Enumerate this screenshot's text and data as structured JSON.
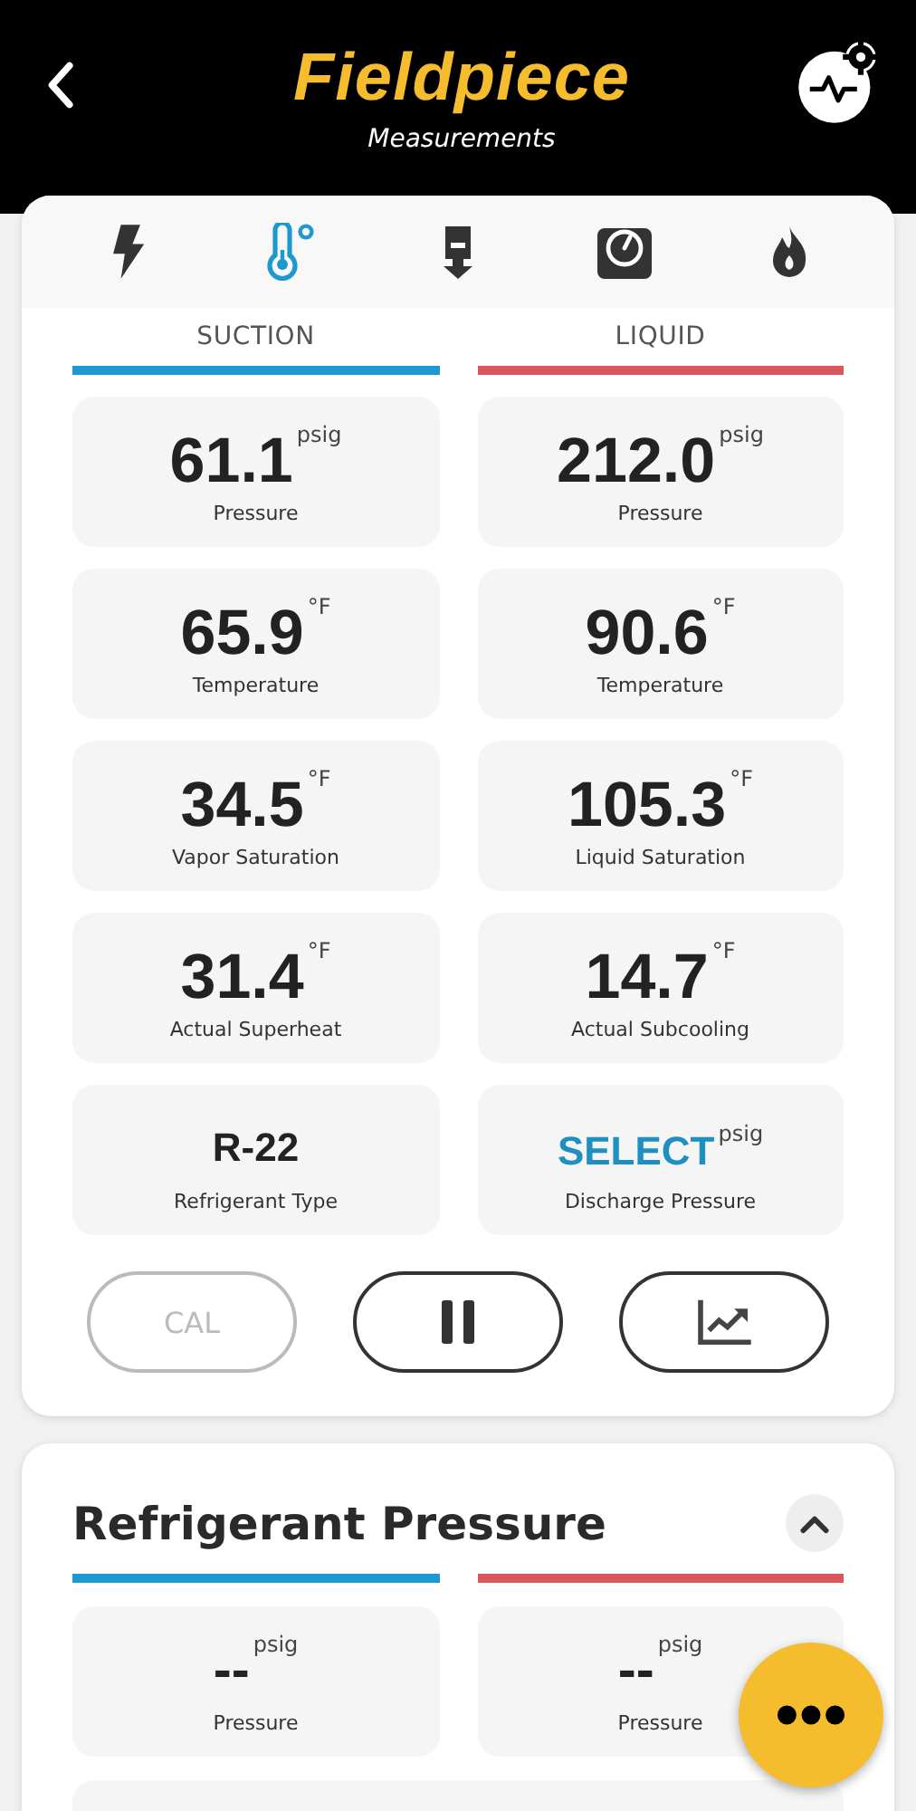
{
  "header": {
    "logo": "Fieldpiece",
    "subtitle": "Measurements"
  },
  "tabs": [
    {
      "kind": "bolt",
      "selected": false
    },
    {
      "kind": "thermometer",
      "selected": true
    },
    {
      "kind": "probe",
      "selected": false
    },
    {
      "kind": "gauge",
      "selected": false
    },
    {
      "kind": "flame",
      "selected": false
    }
  ],
  "columns": [
    {
      "label": "SUCTION",
      "color": "#1e98d0"
    },
    {
      "label": "LIQUID",
      "color": "#d9575c"
    }
  ],
  "tiles": [
    {
      "kind": "value",
      "value": "61.1",
      "unit": "psig",
      "label": "Pressure"
    },
    {
      "kind": "value",
      "value": "212.0",
      "unit": "psig",
      "label": "Pressure"
    },
    {
      "kind": "value",
      "value": "65.9",
      "unit": "°F",
      "label": "Temperature"
    },
    {
      "kind": "value",
      "value": "90.6",
      "unit": "°F",
      "label": "Temperature"
    },
    {
      "kind": "value",
      "value": "34.5",
      "unit": "°F",
      "label": "Vapor Saturation"
    },
    {
      "kind": "value",
      "value": "105.3",
      "unit": "°F",
      "label": "Liquid Saturation"
    },
    {
      "kind": "value",
      "value": "31.4",
      "unit": "°F",
      "label": "Actual Superheat"
    },
    {
      "kind": "value",
      "value": "14.7",
      "unit": "°F",
      "label": "Actual Subcooling"
    },
    {
      "kind": "text",
      "value": "R-22",
      "label": "Refrigerant Type"
    },
    {
      "kind": "select",
      "value": "SELECT",
      "unit": "psig",
      "label": "Discharge Pressure"
    }
  ],
  "buttons": [
    {
      "kind": "text",
      "label": "CAL",
      "disabled": true
    },
    {
      "kind": "pause",
      "disabled": false
    },
    {
      "kind": "chart",
      "disabled": false
    }
  ],
  "section": {
    "title": "Refrigerant Pressure",
    "expanded": true,
    "columns": [
      {
        "color": "#1e98d0"
      },
      {
        "color": "#d9575c"
      }
    ],
    "tiles": [
      {
        "value": "--",
        "unit": "psig",
        "label": "Pressure"
      },
      {
        "value": "--",
        "unit": "psig",
        "label": "Pressure"
      }
    ]
  }
}
